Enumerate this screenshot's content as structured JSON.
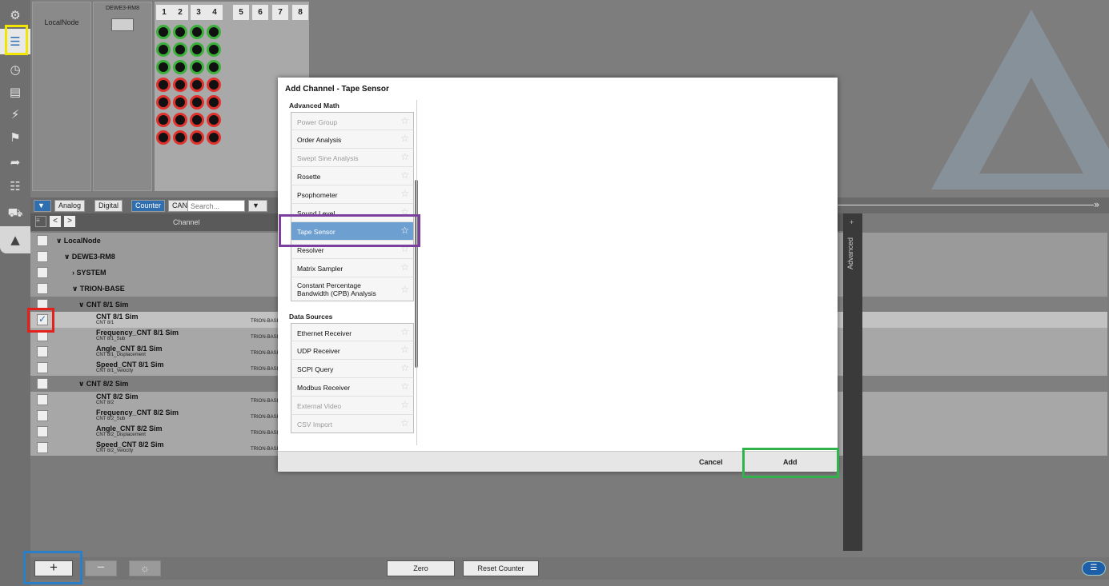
{
  "rail": {
    "icons": [
      "gear-icon",
      "channel-list-icon",
      "gauge-icon",
      "document-icon",
      "lightning-icon",
      "flag-icon",
      "export-icon",
      "network-icon",
      "car-icon",
      "logo-tab-icon"
    ]
  },
  "device_area": {
    "node_label": "LocalNode",
    "device_label": "DEWE3-RM8",
    "slots": [
      "1",
      "2",
      "3",
      "4",
      "5",
      "6",
      "7",
      "8"
    ]
  },
  "filter_bar": {
    "buttons": [
      "Analog",
      "Digital",
      "Counter",
      "CAN"
    ],
    "search_placeholder": "Search..."
  },
  "table": {
    "header_channel": "Channel",
    "rows": [
      {
        "label": "LocalNode",
        "sub": "",
        "amp": ""
      },
      {
        "label": "DEWE3-RM8",
        "sub": "",
        "amp": ""
      },
      {
        "label": "SYSTEM",
        "sub": "",
        "amp": ""
      },
      {
        "label": "TRION-BASE",
        "sub": "",
        "amp": ""
      },
      {
        "label": "CNT 8/1 Sim",
        "sub": "",
        "amp": ""
      },
      {
        "label": "CNT 8/1 Sim",
        "sub": "CNT 8/1",
        "amp": "TRION-BASE"
      },
      {
        "label": "Frequency_CNT 8/1 Sim",
        "sub": "CNT 8/1_Sub",
        "amp": "TRION-BASE"
      },
      {
        "label": "Angle_CNT 8/1 Sim",
        "sub": "CNT 8/1_Displacement",
        "amp": "TRION-BASE"
      },
      {
        "label": "Speed_CNT 8/1 Sim",
        "sub": "CNT 8/1_Velocity",
        "amp": "TRION-BASE"
      },
      {
        "label": "CNT 8/2 Sim",
        "sub": "",
        "amp": ""
      },
      {
        "label": "CNT 8/2 Sim",
        "sub": "CNT 8/2",
        "amp": "TRION-BASE"
      },
      {
        "label": "Frequency_CNT 8/2 Sim",
        "sub": "CNT 8/2_Sub",
        "amp": "TRION-BASE"
      },
      {
        "label": "Angle_CNT 8/2 Sim",
        "sub": "CNT 8/2_Displacement",
        "amp": "TRION-BASE"
      },
      {
        "label": "Speed_CNT 8/2 Sim",
        "sub": "CNT 8/2_Velocity",
        "amp": "TRION-BASE"
      }
    ]
  },
  "side_panel": {
    "label": "Advanced"
  },
  "bottom_bar": {
    "zero": "Zero",
    "reset_counter": "Reset Counter"
  },
  "modal": {
    "title": "Add Channel - Tape Sensor",
    "groups": [
      {
        "title": "Advanced Math",
        "items": [
          {
            "label": "Power Group",
            "disabled": true
          },
          {
            "label": "Order Analysis",
            "disabled": false
          },
          {
            "label": "Swept Sine Analysis",
            "disabled": true
          },
          {
            "label": "Rosette",
            "disabled": false
          },
          {
            "label": "Psophometer",
            "disabled": false
          },
          {
            "label": "Sound Level",
            "disabled": false
          },
          {
            "label": "Tape Sensor",
            "disabled": false,
            "selected": true
          },
          {
            "label": "Resolver",
            "disabled": false
          },
          {
            "label": "Matrix Sampler",
            "disabled": false
          },
          {
            "label": "Constant Percentage Bandwidth (CPB) Analysis",
            "disabled": false
          }
        ]
      },
      {
        "title": "Data Sources",
        "items": [
          {
            "label": "Ethernet Receiver",
            "disabled": false
          },
          {
            "label": "UDP Receiver",
            "disabled": false
          },
          {
            "label": "SCPI Query",
            "disabled": false
          },
          {
            "label": "Modbus Receiver",
            "disabled": false
          },
          {
            "label": "External Video",
            "disabled": true
          },
          {
            "label": "CSV Import",
            "disabled": true
          }
        ]
      }
    ],
    "cancel": "Cancel",
    "add": "Add"
  },
  "colors": {
    "accent": "#2f6fb0",
    "selected_item": "#6d9fd1",
    "highlight_yellow": "#f2e600",
    "highlight_red": "#e3201b",
    "highlight_purple": "#7b3fa0",
    "highlight_green": "#2fb34a",
    "highlight_blue": "#2a7fc9"
  }
}
